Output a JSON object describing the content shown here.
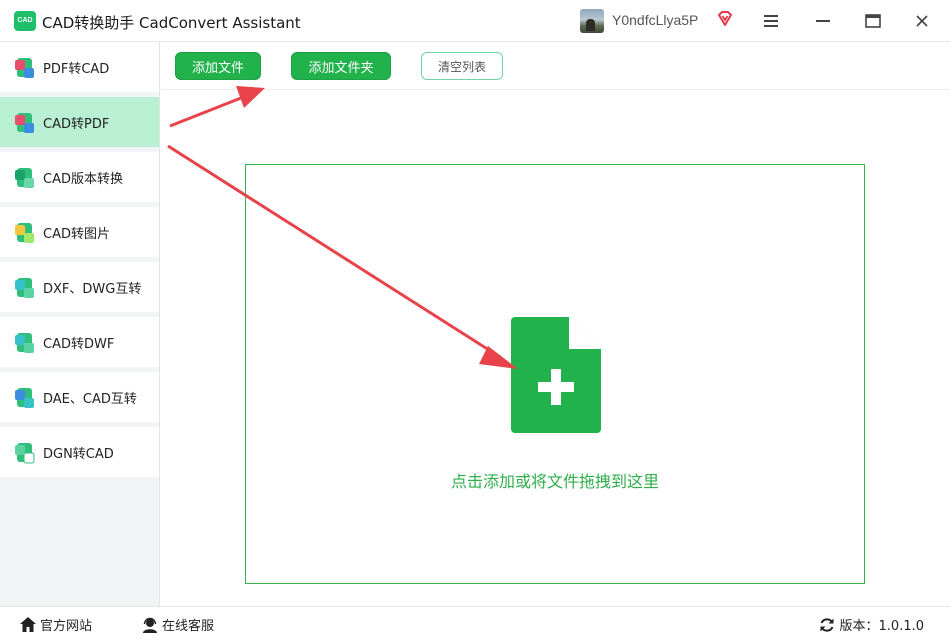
{
  "window": {
    "logo_text": "CAD",
    "title": "CAD转换助手 CadConvert Assistant",
    "username": "Y0ndfcLlya5P"
  },
  "sidebar": {
    "items": [
      {
        "label": "PDF转CAD",
        "icon": "pdf-to-cad-icon",
        "active": false
      },
      {
        "label": "CAD转PDF",
        "icon": "cad-to-pdf-icon",
        "active": true
      },
      {
        "label": "CAD版本转换",
        "icon": "cad-version-icon",
        "active": false
      },
      {
        "label": "CAD转图片",
        "icon": "cad-to-image-icon",
        "active": false
      },
      {
        "label": "DXF、DWG互转",
        "icon": "dxf-dwg-icon",
        "active": false
      },
      {
        "label": "CAD转DWF",
        "icon": "cad-to-dwf-icon",
        "active": false
      },
      {
        "label": "DAE、CAD互转",
        "icon": "dae-cad-icon",
        "active": false
      },
      {
        "label": "DGN转CAD",
        "icon": "dgn-to-cad-icon",
        "active": false
      }
    ]
  },
  "toolbar": {
    "add_file": "添加文件",
    "add_folder": "添加文件夹",
    "clear_list": "清空列表"
  },
  "dropzone": {
    "text": "点击添加或将文件拖拽到这里",
    "icon": "file-plus-icon"
  },
  "footer": {
    "website": "官方网站",
    "support": "在线客服",
    "version": "版本：1.0.1.0"
  },
  "colors": {
    "accent": "#22b24c",
    "active_item_bg": "#b9f0d3",
    "drop_text": "#2fae4b",
    "arrow": "#e8434b"
  }
}
